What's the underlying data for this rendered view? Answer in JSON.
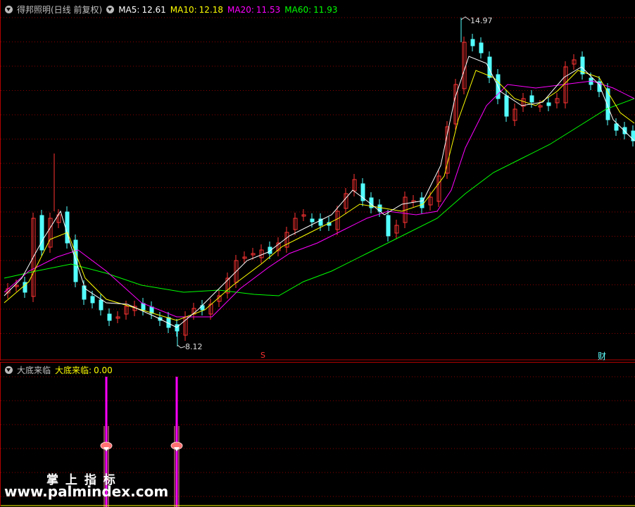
{
  "main": {
    "title": "得邦照明(日线 前复权)",
    "ma5": {
      "label": "MA5:",
      "value": "12.61",
      "color": "#ffffff"
    },
    "ma10": {
      "label": "MA10:",
      "value": "12.18",
      "color": "#ffff00"
    },
    "ma20": {
      "label": "MA20:",
      "value": "11.53",
      "color": "#ff00ff"
    },
    "ma60": {
      "label": "MA60:",
      "value": "11.93",
      "color": "#00ff00"
    },
    "high_label": "14.97",
    "low_label": "8.12",
    "marker_s": "S",
    "marker_cai": "财"
  },
  "indicator": {
    "name": "大底来临",
    "line_label": "大底来临:",
    "line_value": "0.00"
  },
  "watermark": {
    "title": "掌 上 指 标",
    "url": "www.palmindex.com"
  },
  "colors": {
    "up": "#ff3232",
    "down": "#54ffff",
    "grid": "#8b0000",
    "ma5": "#ffffff",
    "ma10": "#ffff00",
    "ma20": "#ff00ff",
    "ma60": "#00ff00",
    "signal": "#ff00ff"
  }
}
